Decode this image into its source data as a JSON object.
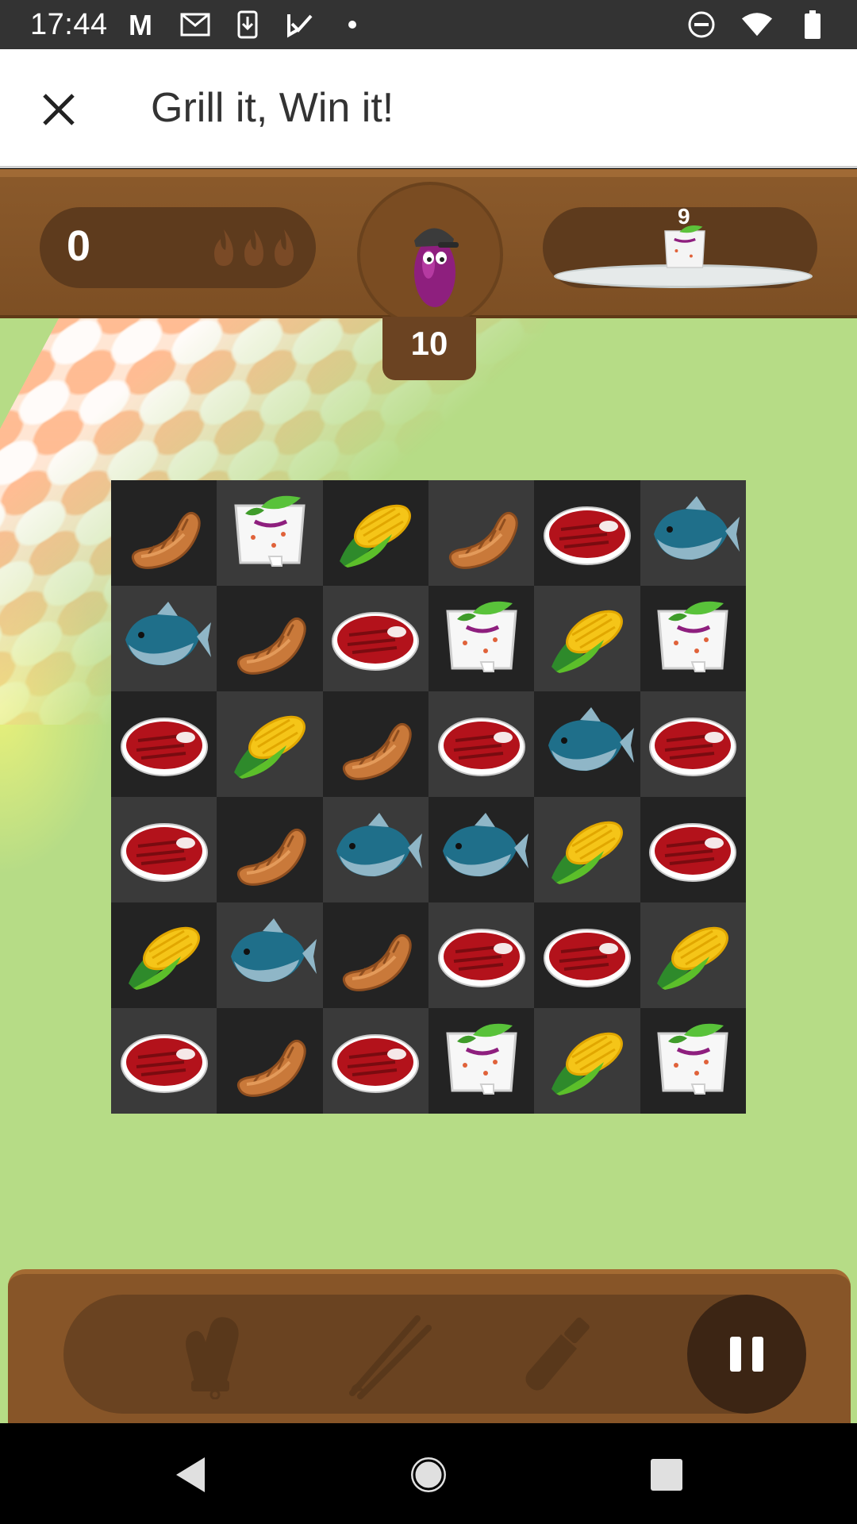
{
  "status_bar": {
    "time": "17:44",
    "left_icons": [
      "gmail-m-icon",
      "gmail-outline-icon",
      "download-icon",
      "task-check-icon",
      "dot-icon"
    ],
    "right_icons": [
      "do-not-disturb-icon",
      "wifi-icon",
      "battery-icon"
    ]
  },
  "app_bar": {
    "title": "Grill it, Win it!",
    "close_icon": "close-icon"
  },
  "hud": {
    "score": "0",
    "flames_count": 3,
    "character": "eggplant-chef-icon",
    "moves": "10",
    "goal": {
      "item": "tofu",
      "count": "9"
    }
  },
  "board": {
    "rows": 6,
    "cols": 6,
    "pieces": [
      [
        "sausage",
        "tofu",
        "corn",
        "sausage",
        "steak",
        "fish"
      ],
      [
        "fish",
        "sausage",
        "steak",
        "tofu",
        "corn",
        "tofu"
      ],
      [
        "steak",
        "corn",
        "sausage",
        "steak",
        "fish",
        "steak"
      ],
      [
        "steak",
        "sausage",
        "fish",
        "fish",
        "corn",
        "steak"
      ],
      [
        "corn",
        "fish",
        "sausage",
        "steak",
        "steak",
        "corn"
      ],
      [
        "steak",
        "sausage",
        "steak",
        "tofu",
        "corn",
        "tofu"
      ]
    ]
  },
  "tools": [
    "oven-mitt-icon",
    "tongs-icon",
    "sauce-bottle-icon"
  ],
  "pause_icon": "pause-icon",
  "nav_bar": [
    "back-icon",
    "home-icon",
    "recents-icon"
  ],
  "colors": {
    "background_green": "#b6dc86",
    "wood": "#8b5a2b",
    "wood_dark": "#5e3b1d",
    "cell_dark": "#232323",
    "cell_light": "#3a3a3a"
  }
}
